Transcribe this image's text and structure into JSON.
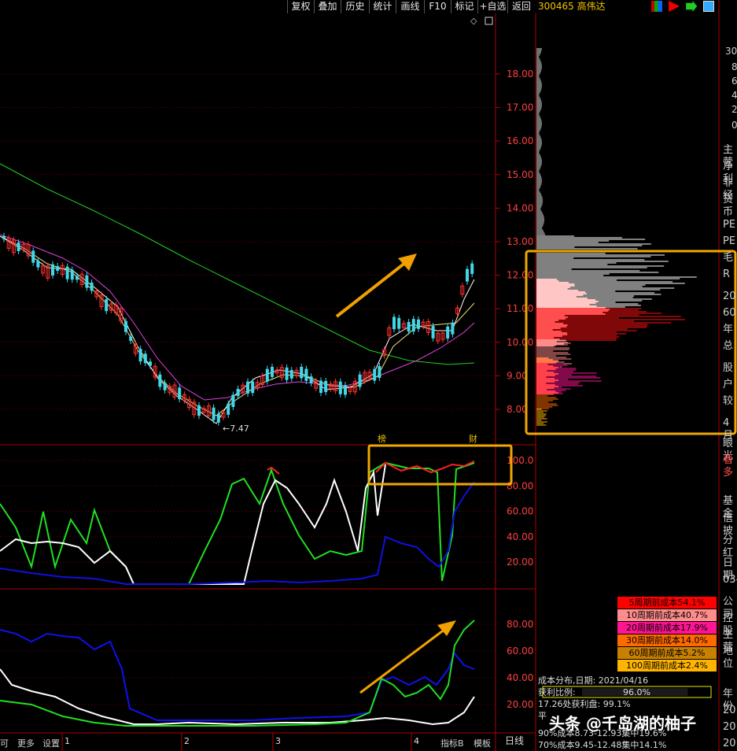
{
  "toolbar": {
    "buttons": [
      "复权",
      "叠加",
      "历史",
      "统计",
      "画线",
      "F10",
      "标记",
      "+自选",
      "返回"
    ],
    "stock_code_name": "300465 高伟达"
  },
  "main_chart": {
    "y_ticks": [
      "18.00",
      "17.00",
      "16.00",
      "15.00",
      "14.00",
      "13.00",
      "12.00",
      "11.00",
      "10.00",
      "9.00",
      "8.00"
    ],
    "low_label": "←7.47",
    "markers": [
      "榜",
      "财"
    ]
  },
  "indicator1": {
    "y_ticks": [
      "100.0",
      "80.00",
      "60.00",
      "40.00",
      "20.00"
    ]
  },
  "indicator2": {
    "y_ticks": [
      "80.00",
      "60.00",
      "40.00",
      "20.00"
    ]
  },
  "x_axis": {
    "months": [
      "1",
      "2",
      "3",
      "4"
    ],
    "period_label": "日线"
  },
  "cost_legend": [
    {
      "label": "5周期前成本54.1%",
      "bg": "#ff0000",
      "fg": "#000000"
    },
    {
      "label": "10周期前成本40.7%",
      "bg": "#ff8c8c",
      "fg": "#000000"
    },
    {
      "label": "20周期前成本17.9%",
      "bg": "#ff1493",
      "fg": "#000000"
    },
    {
      "label": "30周期前成本14.0%",
      "bg": "#ff6a00",
      "fg": "#000000"
    },
    {
      "label": "60周期前成本5.2%",
      "bg": "#c88000",
      "fg": "#000000"
    },
    {
      "label": "100周期前成本2.4%",
      "bg": "#ffb400",
      "fg": "#000000"
    }
  ],
  "cost_info": {
    "date_line": "成本分布,日期:  2021/04/16",
    "profit_label": "获利比例:",
    "profit_value": "96.0%",
    "profit_ratio": 0.96,
    "line3": "17.26处获利盘:  99.1%",
    "line4": "平",
    "line5": "90%成本8.73-12.93集中19.6%",
    "line6": "70%成本9.45-12.48集中14.1%"
  },
  "right_panel": {
    "top_numbers": [
      "30",
      "8",
      "6",
      "4",
      "2",
      "0"
    ],
    "labels": [
      "主营",
      "净利",
      "非经",
      "货币",
      "PE",
      "PE",
      "毛",
      "R",
      "20",
      "60",
      "年",
      "总",
      "股",
      "户",
      "较",
      "4月",
      "眼光",
      "看多",
      "基金",
      "信披",
      "分红",
      "日期",
      "03-",
      "公司",
      "控股",
      "主营",
      "地位",
      "年份",
      "20",
      "20",
      "20"
    ]
  },
  "bottom_tabs": [
    "可",
    "更多",
    "设置",
    "指标B",
    "模板"
  ],
  "watermark": "头条 @千岛湖的柚子"
}
